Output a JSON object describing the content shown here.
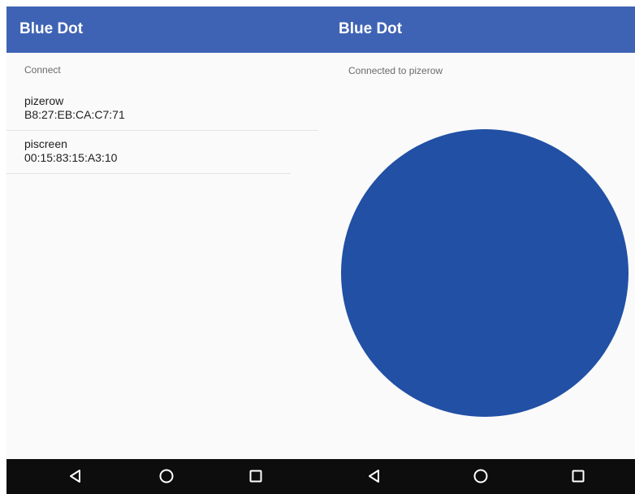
{
  "left_screen": {
    "app_title": "Blue Dot",
    "connect_label": "Connect",
    "devices": [
      {
        "name": "pizerow",
        "address": "B8:27:EB:CA:C7:71"
      },
      {
        "name": "piscreen",
        "address": "00:15:83:15:A3:10"
      }
    ]
  },
  "right_screen": {
    "app_title": "Blue Dot",
    "status_icon": "bluetooth-icon",
    "status_text": "Connected to pizerow",
    "dot_color": "#2150a5"
  },
  "navigation_bar": {
    "buttons": [
      "back-icon",
      "home-icon",
      "recents-icon"
    ]
  },
  "colors": {
    "app_bar": "#3f63b4",
    "dot": "#2150a5",
    "nav_bar": "#0d0d0d"
  }
}
